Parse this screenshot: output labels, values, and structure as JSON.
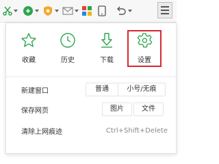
{
  "toolbar": {
    "icons": [
      "scissors-icon",
      "green-circle-icon",
      "shield-icon",
      "mail-icon",
      "apps-grid-icon",
      "phone-icon",
      "undo-icon",
      "menu-icon"
    ]
  },
  "quick_actions": [
    {
      "name": "favorites",
      "label": "收藏",
      "icon": "star-icon"
    },
    {
      "name": "history",
      "label": "历史",
      "icon": "clock-icon"
    },
    {
      "name": "downloads",
      "label": "下载",
      "icon": "download-icon"
    },
    {
      "name": "settings",
      "label": "设置",
      "icon": "gear-icon",
      "highlighted": true
    }
  ],
  "menu": {
    "new_window": {
      "label": "新建窗口",
      "option_normal": "普通",
      "option_private": "小号/无痕"
    },
    "save_page": {
      "label": "保存网页",
      "option_image": "图片",
      "option_file": "文件"
    },
    "clear_traces": {
      "label": "清除上网痕迹",
      "shortcut": "Ctrl+Shift+Delete"
    }
  },
  "colors": {
    "accent_green": "#2ea44f",
    "highlight_red": "#d7262c"
  }
}
